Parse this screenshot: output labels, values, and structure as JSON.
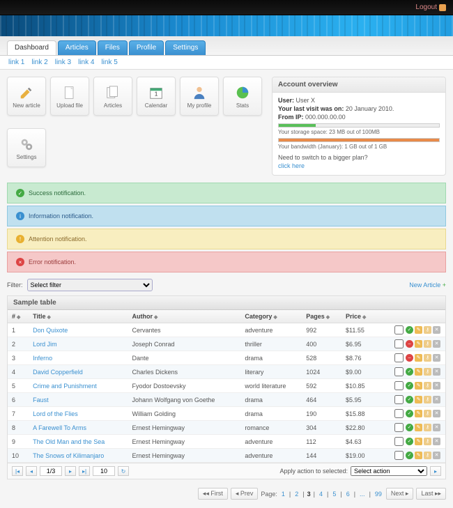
{
  "topbar": {
    "logout": "Logout"
  },
  "tabs": [
    "Dashboard",
    "Articles",
    "Files",
    "Profile",
    "Settings"
  ],
  "active_tab": 0,
  "sublinks": [
    "link 1",
    "link 2",
    "link 3",
    "link 4",
    "link 5"
  ],
  "tiles": [
    {
      "id": "new-article",
      "label": "New article",
      "icon": "pencil"
    },
    {
      "id": "upload-file",
      "label": "Upload file",
      "icon": "doc"
    },
    {
      "id": "articles",
      "label": "Articles",
      "icon": "docs"
    },
    {
      "id": "calendar",
      "label": "Calendar",
      "icon": "cal"
    },
    {
      "id": "my-profile",
      "label": "My profile",
      "icon": "user"
    },
    {
      "id": "stats",
      "label": "Stats",
      "icon": "pie"
    },
    {
      "id": "settings",
      "label": "Settings",
      "icon": "gear"
    }
  ],
  "overview": {
    "title": "Account overview",
    "user_label": "User:",
    "user": "User X",
    "visit_label": "Your last visit was on:",
    "visit": "20 January 2010.",
    "ip_label": "From IP:",
    "ip": "000.000.00.00",
    "storage": {
      "cap": "Your storage space: 23 MB out of 100MB",
      "pct": 23,
      "color": "#5abf5a"
    },
    "bandwidth": {
      "cap": "Your bandwidth (January): 1 GB out of 1 GB",
      "pct": 100,
      "color": "#e88a4a"
    },
    "plan_q": "Need to switch to a bigger plan?",
    "plan_link": "click here"
  },
  "notices": {
    "success": "Success notification.",
    "info": "Information notification.",
    "warn": "Attention notification.",
    "error": "Error notification."
  },
  "filter": {
    "label": "Filter:",
    "placeholder": "Select filter",
    "new_article": "New Article"
  },
  "table": {
    "title": "Sample table",
    "cols": [
      "#",
      "Title",
      "Author",
      "Category",
      "Pages",
      "Price",
      ""
    ],
    "rows": [
      {
        "n": 1,
        "title": "Don Quixote",
        "author": "Cervantes",
        "cat": "adventure",
        "pages": 992,
        "price": "$11.55",
        "ok": true
      },
      {
        "n": 2,
        "title": "Lord Jim",
        "author": "Joseph Conrad",
        "cat": "thriller",
        "pages": 400,
        "price": "$6.95",
        "ok": false
      },
      {
        "n": 3,
        "title": "Inferno",
        "author": "Dante",
        "cat": "drama",
        "pages": 528,
        "price": "$8.76",
        "ok": false
      },
      {
        "n": 4,
        "title": "David Copperfield",
        "author": "Charles Dickens",
        "cat": "literary",
        "pages": 1024,
        "price": "$9.00",
        "ok": true
      },
      {
        "n": 5,
        "title": "Crime and Punishment",
        "author": "Fyodor Dostoevsky",
        "cat": "world literature",
        "pages": 592,
        "price": "$10.85",
        "ok": true
      },
      {
        "n": 6,
        "title": "Faust",
        "author": "Johann Wolfgang von Goethe",
        "cat": "drama",
        "pages": 464,
        "price": "$5.95",
        "ok": true
      },
      {
        "n": 7,
        "title": "Lord of the Flies",
        "author": "William Golding",
        "cat": "drama",
        "pages": 190,
        "price": "$15.88",
        "ok": true
      },
      {
        "n": 8,
        "title": "A Farewell To Arms",
        "author": "Ernest Hemingway",
        "cat": "romance",
        "pages": 304,
        "price": "$22.80",
        "ok": true
      },
      {
        "n": 9,
        "title": "The Old Man and the Sea",
        "author": "Ernest Hemingway",
        "cat": "adventure",
        "pages": 112,
        "price": "$4.63",
        "ok": true
      },
      {
        "n": 10,
        "title": "The Snows of Kilimanjaro",
        "author": "Ernest Hemingway",
        "cat": "adventure",
        "pages": 144,
        "price": "$19.00",
        "ok": true
      }
    ]
  },
  "tfoot": {
    "page": "1/3",
    "perpage": "10",
    "apply_label": "Apply action to selected:",
    "action_placeholder": "Select action"
  },
  "pager": {
    "label": "Page:",
    "pages": [
      "1",
      "2",
      "3",
      "4",
      "5",
      "6",
      "...",
      "99"
    ],
    "current": "3",
    "first": "First",
    "prev": "Prev",
    "next": "Next",
    "last": "Last"
  }
}
